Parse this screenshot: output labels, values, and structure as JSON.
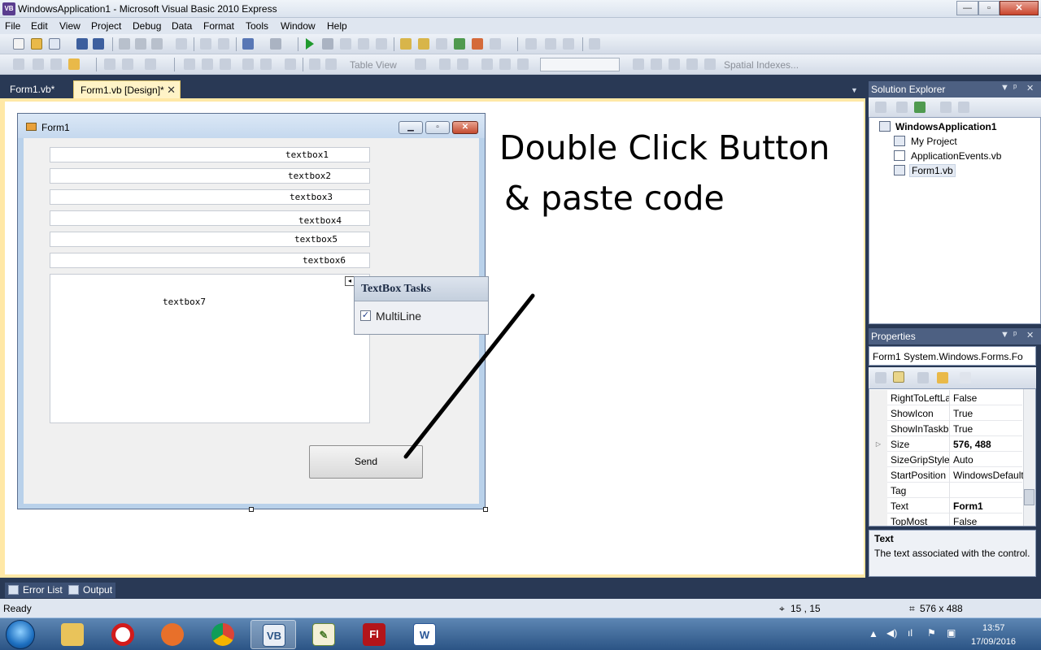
{
  "window": {
    "title": "WindowsApplication1 - Microsoft Visual Basic 2010 Express",
    "minimize": "—",
    "maximize": "▫",
    "close": "✕"
  },
  "menu": [
    "File",
    "Edit",
    "View",
    "Project",
    "Debug",
    "Data",
    "Format",
    "Tools",
    "Window",
    "Help"
  ],
  "toolbar2": {
    "table_view": "Table View",
    "spatial_indexes": "Spatial Indexes..."
  },
  "doc_tabs": {
    "tab1": "Form1.vb*",
    "tab2": "Form1.vb [Design]*",
    "close": "✕"
  },
  "form1": {
    "title": "Form1",
    "textboxes": [
      "textbox1",
      "textbox2",
      "textbox3",
      "textbox4",
      "textbox5",
      "textbox6"
    ],
    "textbox7": "textbox7",
    "send_button": "Send"
  },
  "tasks": {
    "title": "TextBox Tasks",
    "multiline_label": "MultiLine",
    "multiline_checked": true,
    "check": "✓"
  },
  "annotation": {
    "line1": "Double Click Button",
    "line2": "& paste code"
  },
  "solution_explorer": {
    "title": "Solution Explorer",
    "items": [
      "WindowsApplication1",
      "My Project",
      "ApplicationEvents.vb",
      "Form1.vb"
    ]
  },
  "properties": {
    "title": "Properties",
    "object": "Form1 System.Windows.Forms.Fo",
    "rows": [
      {
        "name": "RightToLeftLa",
        "value": "False"
      },
      {
        "name": "ShowIcon",
        "value": "True"
      },
      {
        "name": "ShowInTaskb",
        "value": "True"
      },
      {
        "name": "Size",
        "value": "576, 488"
      },
      {
        "name": "SizeGripStyle",
        "value": "Auto"
      },
      {
        "name": "StartPosition",
        "value": "WindowsDefault"
      },
      {
        "name": "Tag",
        "value": ""
      },
      {
        "name": "Text",
        "value": "Form1"
      },
      {
        "name": "TopMost",
        "value": "False"
      }
    ],
    "desc_title": "Text",
    "desc_text": "The text associated with the control."
  },
  "bottom_tabs": {
    "error_list": "Error List",
    "output": "Output"
  },
  "status": {
    "ready": "Ready",
    "position": "15 , 15",
    "size": "576 x 488"
  },
  "clock": {
    "time": "13:57",
    "date": "17/09/2016"
  },
  "colors": {
    "vs_chrome": "#293955",
    "design_border": "#ffe8a6"
  }
}
